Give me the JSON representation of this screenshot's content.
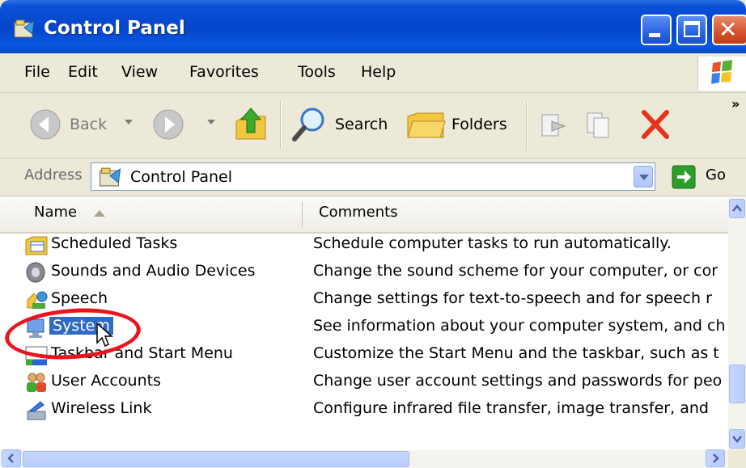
{
  "window": {
    "title": "Control Panel"
  },
  "menu": {
    "items": [
      "File",
      "Edit",
      "View",
      "Favorites",
      "Tools",
      "Help"
    ]
  },
  "toolbar": {
    "back": "Back",
    "search": "Search",
    "folders": "Folders",
    "overflow": "»"
  },
  "address": {
    "label": "Address",
    "value": "Control Panel",
    "go": "Go"
  },
  "columns": {
    "name": "Name",
    "comments": "Comments"
  },
  "rows": [
    {
      "name": "Scheduled Tasks",
      "comment": "Schedule computer tasks to run automatically.",
      "icon": "scheduled-tasks-icon"
    },
    {
      "name": "Sounds and Audio Devices",
      "comment": "Change the sound scheme for your computer, or cor",
      "icon": "speaker-icon"
    },
    {
      "name": "Speech",
      "comment": "Change settings for text-to-speech and for speech r",
      "icon": "speech-icon"
    },
    {
      "name": "System",
      "comment": "See information about your computer system, and ch",
      "icon": "computer-icon",
      "selected": true
    },
    {
      "name": "Taskbar and Start Menu",
      "comment": "Customize the Start Menu and the taskbar, such as t",
      "icon": "taskbar-icon"
    },
    {
      "name": "User Accounts",
      "comment": "Change user account settings and passwords for peo",
      "icon": "users-icon"
    },
    {
      "name": "Wireless Link",
      "comment": "Configure infrared file transfer, image transfer, and",
      "icon": "wireless-link-icon"
    }
  ],
  "colors": {
    "title_bar": "#0446cb",
    "selection": "#316ac5",
    "annotation": "#e8141f"
  }
}
